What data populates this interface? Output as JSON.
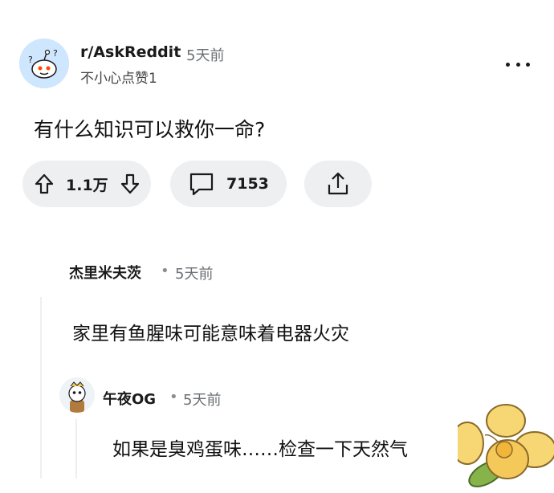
{
  "post": {
    "subreddit": "r/AskReddit",
    "age": "5天前",
    "username": "不小心点赞1",
    "title": "有什么知识可以救你一命?",
    "votes": "1.1万",
    "comments": "7153"
  },
  "comments": [
    {
      "author": "杰里米夫茨",
      "separator": "•",
      "age": "5天前",
      "body": "家里有鱼腥味可能意味着电器火灾"
    },
    {
      "author": "午夜OG",
      "separator": "•",
      "age": "5天前",
      "body": "如果是臭鸡蛋味……检查一下天然气"
    }
  ],
  "icons": {
    "upvote": "arrow-up-icon",
    "downvote": "arrow-down-icon",
    "comment": "speech-bubble-icon",
    "share": "share-icon",
    "more": "more-options-icon"
  },
  "colors": {
    "pill_bg": "#edeff1",
    "meta_gray": "#6b6f73",
    "avatar_bg": "#cfe6ff"
  }
}
